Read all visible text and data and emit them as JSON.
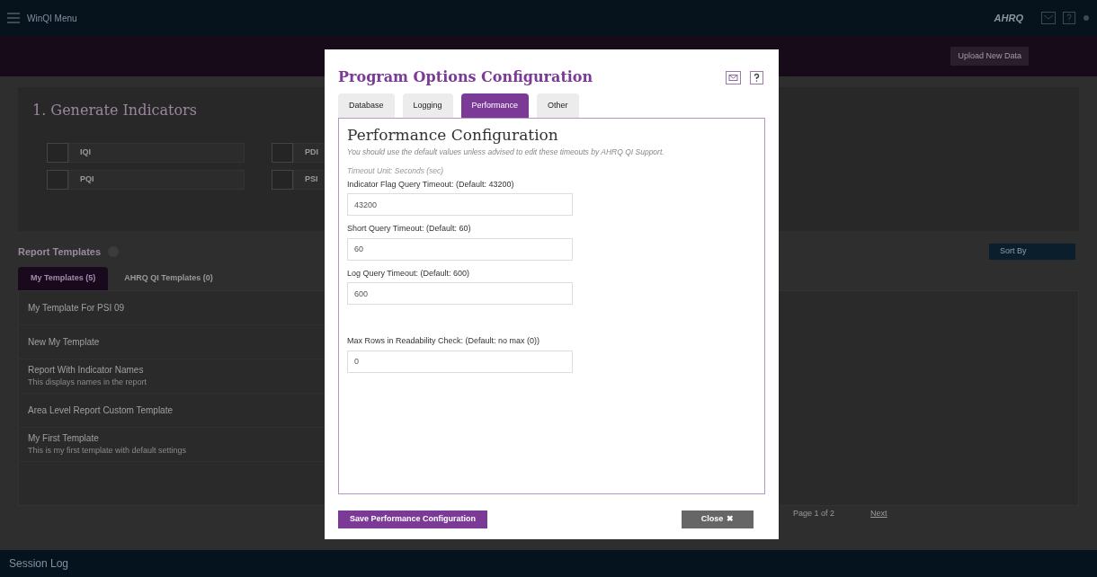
{
  "top_bar": {
    "menu_label": "WinQI Menu",
    "logo": "AHRQ"
  },
  "data_bar": {
    "upload_button": "Upload New Data"
  },
  "background": {
    "generate_title": "1. Generate Indicators",
    "modules": [
      {
        "label": "IQI",
        "checked": false
      },
      {
        "label": "PDI",
        "checked": false
      },
      {
        "label": "PQI",
        "checked": false
      },
      {
        "label": "PSI",
        "checked": false
      }
    ],
    "report_templates_title": "Report Templates",
    "template_tabs": [
      {
        "label": "My Templates (5)",
        "selected": true
      },
      {
        "label": "AHRQ QI Templates (0)",
        "selected": false
      }
    ],
    "templates": [
      {
        "name": "My Template For PSI 09"
      },
      {
        "name": "New My Template"
      },
      {
        "name": "Report With Indicator Names",
        "description": "This displays names in the report"
      },
      {
        "name": "Area Level Report Custom Template"
      },
      {
        "name": "My First Template",
        "description": "This is my first template with default settings"
      }
    ],
    "sort_label": "Sort By",
    "pager": "Page 1 of 2",
    "next": "Next"
  },
  "session_log": {
    "title": "Session Log"
  },
  "dialog": {
    "title": "Program Options Configuration",
    "tabs": [
      {
        "label": "Database",
        "selected": false
      },
      {
        "label": "Logging",
        "selected": false
      },
      {
        "label": "Performance",
        "selected": true
      },
      {
        "label": "Other",
        "selected": false
      }
    ],
    "heading": "Performance Configuration",
    "note": "You should use the default values unless advised to edit these timeouts by AHRQ QI Support.",
    "unit_note": "Timeout Unit: Seconds (sec)",
    "fields": [
      {
        "label": "Indicator Flag Query Timeout: (Default: 43200)",
        "value": "43200"
      },
      {
        "label": "Short Query Timeout: (Default: 60)",
        "value": "60"
      },
      {
        "label": "Log Query Timeout: (Default: 600)",
        "value": "600"
      },
      {
        "label": "Max Rows in Readability Check: (Default: no max (0))",
        "value": "0",
        "gap_before": true
      }
    ],
    "save_button": "Save Performance Configuration",
    "close_button": "Close",
    "close_icon": "✖"
  }
}
